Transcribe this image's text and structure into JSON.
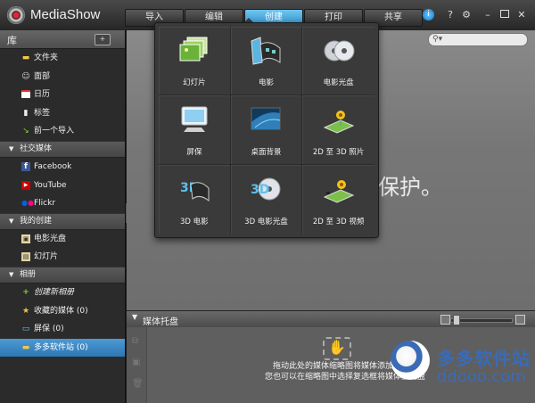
{
  "app": {
    "title": "MediaShow"
  },
  "tabs": [
    {
      "label": "导入"
    },
    {
      "label": "编辑"
    },
    {
      "label": "创建"
    },
    {
      "label": "打印"
    },
    {
      "label": "共享"
    }
  ],
  "active_tab": "创建",
  "window_controls": {
    "info": "i",
    "help": "?",
    "settings": "⚙",
    "minimize": "–",
    "close": "✕"
  },
  "sidebar": {
    "library_title": "库",
    "library_items": [
      {
        "label": "文件夹",
        "icon": "folder-icon"
      },
      {
        "label": "面部",
        "icon": "face-icon"
      },
      {
        "label": "日历",
        "icon": "calendar-icon"
      },
      {
        "label": "标签",
        "icon": "tag-icon"
      },
      {
        "label": "前一个导入",
        "icon": "import-icon"
      }
    ],
    "social_title": "社交媒体",
    "social_items": [
      {
        "label": "Facebook",
        "icon": "facebook-icon"
      },
      {
        "label": "YouTube",
        "icon": "youtube-icon"
      },
      {
        "label": "Flickr",
        "icon": "flickr-icon"
      }
    ],
    "creations_title": "我的创建",
    "creations_items": [
      {
        "label": "电影光盘",
        "icon": "movie-disc-icon"
      },
      {
        "label": "幻灯片",
        "icon": "slideshow-icon"
      }
    ],
    "albums_title": "相册",
    "albums_items": [
      {
        "label": "创建新相册",
        "icon": "plus-icon"
      },
      {
        "label": "收藏的媒体 (0)",
        "icon": "star-icon"
      },
      {
        "label": "屏保 (0)",
        "icon": "monitor-icon"
      },
      {
        "label": "多多软件站 (0)",
        "icon": "folder-icon"
      }
    ]
  },
  "create_menu": [
    {
      "label": "幻灯片",
      "icon": "slideshow-icon"
    },
    {
      "label": "电影",
      "icon": "movie-film-icon"
    },
    {
      "label": "电影光盘",
      "icon": "disc-icon"
    },
    {
      "label": "屏保",
      "icon": "monitor-icon"
    },
    {
      "label": "桌面背景",
      "icon": "desktop-background-icon"
    },
    {
      "label": "2D 至 3D 照片",
      "icon": "3d-photo-icon"
    },
    {
      "label": "3D 电影",
      "icon": "3d-movie-icon"
    },
    {
      "label": "3D 电影光盘",
      "icon": "3d-disc-icon"
    },
    {
      "label": "2D 至 3D 视频",
      "icon": "3d-video-icon"
    }
  ],
  "main": {
    "message_fragment": "保护。"
  },
  "media_tray": {
    "title": "媒体托盘",
    "hint_line1": "拖动此处的媒体缩略图将媒体添加至托盘",
    "hint_line2": "您也可以在缩略图中选择复选框将媒体至托盘"
  },
  "watermark": {
    "text": "多多软件站",
    "url": "ddooo.com"
  },
  "colors": {
    "accent": "#3a8fd0",
    "background": "#7a7a7a",
    "watermark": "#3a6bb8"
  }
}
